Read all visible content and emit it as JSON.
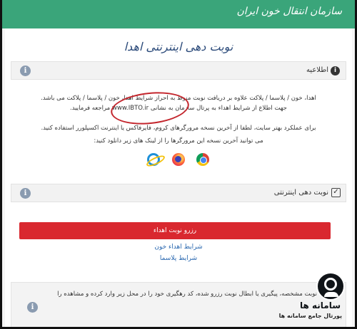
{
  "header": {
    "brand": "سازمان انتقال خون ایران"
  },
  "page_title": "نوبت دهی اینترنتی اهدا",
  "announcement": {
    "label": "اطلاعیه",
    "line1": "اهدا، خون / پلاسما / پلاکت علاوه بر دریافت نوبت منوط به احراز شرایط اهدا، خون / پلاسما / پلاکت می باشد.",
    "line2": "جهت اطلاع از شرایط اهداء به پرتال سازمان به نشانی www.IBTO.ir مراجعه فرمایید.",
    "line3": "برای عملکرد بهتر سایت، لطفا از آخرین نسخه مرورگرهای کروم، فایرفاکس یا اینترنت اکسپلورر استفاده کنید.",
    "line4": "می توانید آخرین نسخه این مرورگرها را از لینک های زیر دانلود کنید:",
    "browsers": [
      "chrome-icon",
      "firefox-icon",
      "internet-explorer-icon"
    ]
  },
  "booking": {
    "label": "نوبت دهی اینترنتی",
    "reserve_button": "رزرو نوبت اهداء",
    "link_blood": "شرایط اهداء خون",
    "link_plasma": "شرایط پلاسما"
  },
  "note": {
    "text": "نوبت مشخصه، پیگیری یا ابطال نوبت رزرو شده، کد رهگیری خود را در محل زیر وارد کرده و مشاهده را"
  },
  "watermark": {
    "title": "سامانه ها",
    "subtitle": "پورتال جامع سامانه ها"
  },
  "colors": {
    "topbar": "#3aa57a",
    "reserve_button": "#d9282f",
    "annotation": "#c3252c",
    "link": "#2a68b0"
  }
}
